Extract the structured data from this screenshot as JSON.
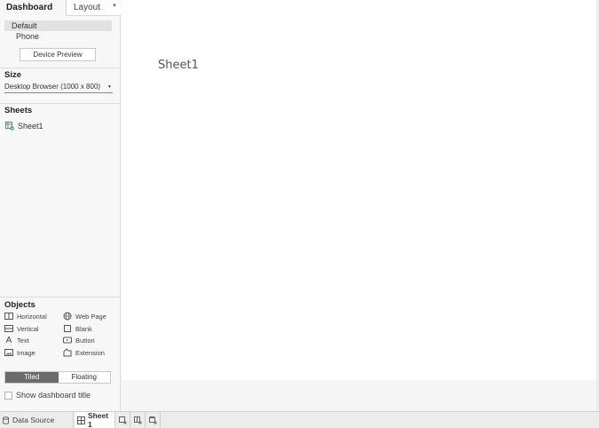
{
  "panel": {
    "tabs": {
      "dashboard": "Dashboard",
      "layout": "Layout"
    },
    "devices": {
      "default": "Default",
      "phone": "Phone",
      "preview_button": "Device Preview"
    },
    "size": {
      "title": "Size",
      "value": "Desktop Browser (1000 x 800)"
    },
    "sheets": {
      "title": "Sheets",
      "items": [
        "Sheet1"
      ]
    },
    "objects": {
      "title": "Objects",
      "items": [
        {
          "label": "Horizontal",
          "icon": "horizontal-container-icon"
        },
        {
          "label": "Web Page",
          "icon": "globe-icon"
        },
        {
          "label": "Vertical",
          "icon": "vertical-container-icon"
        },
        {
          "label": "Blank",
          "icon": "blank-icon"
        },
        {
          "label": "Text",
          "icon": "text-icon"
        },
        {
          "label": "Button",
          "icon": "button-icon"
        },
        {
          "label": "Image",
          "icon": "image-icon"
        },
        {
          "label": "Extension",
          "icon": "extension-icon"
        }
      ]
    },
    "mode": {
      "tiled": "Tiled",
      "floating": "Floating",
      "selected": "Tiled"
    },
    "show_title": {
      "label": "Show dashboard title",
      "checked": false
    }
  },
  "canvas": {
    "sheet_title": "Sheet1"
  },
  "bottom_tabs": {
    "data_source": "Data Source",
    "sheet1": "Sheet 1"
  }
}
